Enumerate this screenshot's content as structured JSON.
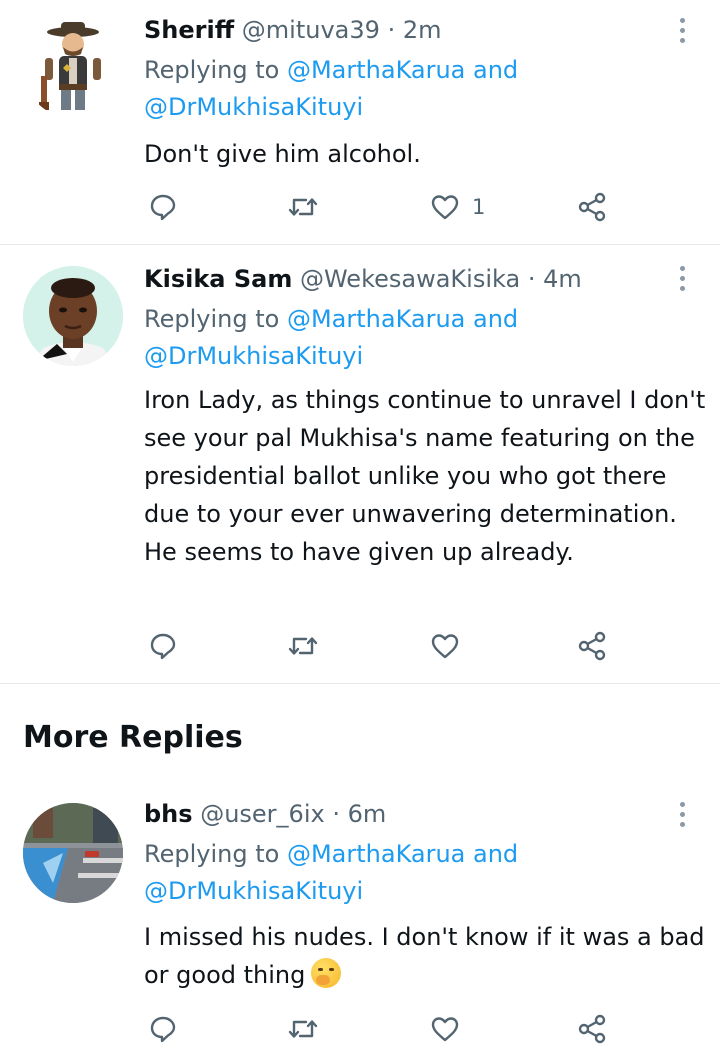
{
  "tweets": [
    {
      "author": "Sheriff",
      "handle": "@mituva39",
      "dot": "·",
      "time": "2m",
      "replying_prefix": "Replying to",
      "mention1": "@MarthaKarua",
      "and": "and",
      "mention2": "@DrMukhisaKituyi",
      "text": "Don't give him alcohol.",
      "like_count": "1",
      "avatar_icon": "cowboy-sheriff-avatar"
    },
    {
      "author": "Kisika Sam",
      "handle": "@WekesawaKisika",
      "dot": "·",
      "time": "4m",
      "replying_prefix": "Replying to",
      "mention1": "@MarthaKarua",
      "and": "and",
      "mention2": "@DrMukhisaKituyi",
      "text": "Iron Lady, as things continue to unravel I don't see your pal Mukhisa's name featuring on the presidential ballot unlike you who got there due to your ever unwavering determination. He seems to have given up already.",
      "avatar_icon": "person-photo-avatar"
    },
    {
      "author": "bhs",
      "handle": "@user_6ix",
      "dot": "·",
      "time": "6m",
      "replying_prefix": "Replying to",
      "mention1": "@MarthaKarua",
      "and": "and",
      "mention2": "@DrMukhisaKituyi",
      "text": "I missed his nudes. I don't know if it was a bad or good thing",
      "emoji": "face-with-hand-over-mouth-emoji",
      "avatar_icon": "street-photo-avatar"
    }
  ],
  "section_title": "More Replies",
  "icons": {
    "reply": "reply-icon",
    "retweet": "retweet-icon",
    "like": "heart-icon",
    "share": "share-icon",
    "more": "more-vertical-icon"
  },
  "colors": {
    "link": "#1d9bf0",
    "secondary_text": "#536471",
    "primary_text": "#0f1419",
    "divider": "#e6e9eb"
  }
}
